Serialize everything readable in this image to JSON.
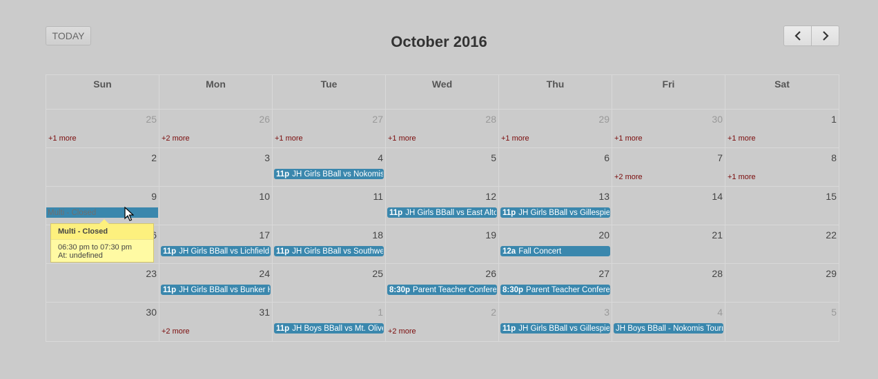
{
  "toolbar": {
    "today_label": "TODAY",
    "title": "October 2016",
    "prev_icon": "chevron-left-icon",
    "next_icon": "chevron-right-icon"
  },
  "weekdays": [
    "Sun",
    "Mon",
    "Tue",
    "Wed",
    "Thu",
    "Fri",
    "Sat"
  ],
  "weeks": [
    {
      "days": [
        {
          "num": "25",
          "other": true,
          "more": "+1 more"
        },
        {
          "num": "26",
          "other": true,
          "more": "+2 more"
        },
        {
          "num": "27",
          "other": true,
          "more": "+1 more"
        },
        {
          "num": "28",
          "other": true,
          "more": "+1 more"
        },
        {
          "num": "29",
          "other": true,
          "more": "+1 more"
        },
        {
          "num": "30",
          "other": true,
          "more": "+1 more"
        },
        {
          "num": "1",
          "more": "+1 more"
        }
      ],
      "events": []
    },
    {
      "days": [
        {
          "num": "2"
        },
        {
          "num": "3"
        },
        {
          "num": "4"
        },
        {
          "num": "5"
        },
        {
          "num": "6"
        },
        {
          "num": "7",
          "more": "+2 more"
        },
        {
          "num": "8",
          "more": "+1 more"
        }
      ],
      "events": [
        {
          "col": 2,
          "time": "11p",
          "title": "JH Girls BBall vs Nokomis"
        }
      ]
    },
    {
      "days": [
        {
          "num": "9"
        },
        {
          "num": "10"
        },
        {
          "num": "11"
        },
        {
          "num": "12"
        },
        {
          "num": "13"
        },
        {
          "num": "14"
        },
        {
          "num": "15"
        }
      ],
      "events": [
        {
          "col": 0,
          "time": "",
          "title": "Multi - Closed",
          "dim": true
        },
        {
          "col": 3,
          "time": "11p",
          "title": "JH Girls BBall vs East Alton"
        },
        {
          "col": 4,
          "time": "11p",
          "title": "JH Girls BBall vs Gillespie"
        }
      ]
    },
    {
      "days": [
        {
          "num": "16"
        },
        {
          "num": "17"
        },
        {
          "num": "18"
        },
        {
          "num": "19"
        },
        {
          "num": "20"
        },
        {
          "num": "21"
        },
        {
          "num": "22"
        }
      ],
      "events": [
        {
          "col": 1,
          "time": "11p",
          "title": "JH Girls BBall vs Lichfield"
        },
        {
          "col": 2,
          "time": "11p",
          "title": "JH Girls BBall vs Southwestern"
        },
        {
          "col": 4,
          "time": "12a",
          "title": "Fall Concert"
        }
      ]
    },
    {
      "days": [
        {
          "num": "23"
        },
        {
          "num": "24"
        },
        {
          "num": "25"
        },
        {
          "num": "26"
        },
        {
          "num": "27"
        },
        {
          "num": "28"
        },
        {
          "num": "29"
        }
      ],
      "events": [
        {
          "col": 1,
          "time": "11p",
          "title": "JH Girls BBall vs Bunker Hill"
        },
        {
          "col": 3,
          "time": "8:30p",
          "title": "Parent Teacher Conferences"
        },
        {
          "col": 4,
          "time": "8:30p",
          "title": "Parent Teacher Conferences"
        }
      ]
    },
    {
      "days": [
        {
          "num": "30"
        },
        {
          "num": "31",
          "more": "+2 more"
        },
        {
          "num": "1",
          "other": true
        },
        {
          "num": "2",
          "other": true,
          "more": "+2 more"
        },
        {
          "num": "3",
          "other": true
        },
        {
          "num": "4",
          "other": true
        },
        {
          "num": "5",
          "other": true
        }
      ],
      "events": [
        {
          "col": 2,
          "time": "11p",
          "title": "JH Boys BBall vs Mt. Olive"
        },
        {
          "col": 4,
          "time": "11p",
          "title": "JH Girls BBall vs Gillespie"
        },
        {
          "col": 5,
          "time": "",
          "title": "JH Boys BBall - Nokomis Tournament"
        }
      ]
    }
  ],
  "tooltip": {
    "title": "Multi - Closed",
    "time": "06:30 pm to 07:30 pm",
    "location": "At: undefined"
  },
  "colors": {
    "background": "#cbcbcb",
    "event": "#3a87ad",
    "more_link": "#7a0a0a",
    "tooltip": "#fffaa3"
  }
}
